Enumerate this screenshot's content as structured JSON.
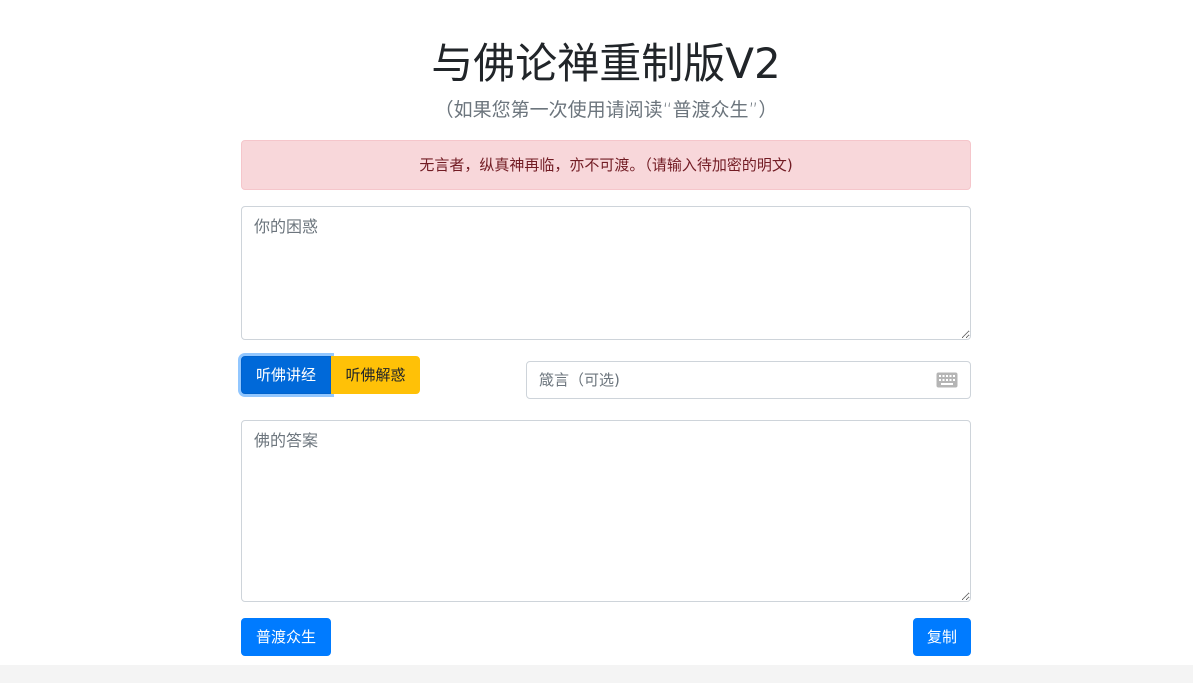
{
  "header": {
    "title": "与佛论禅重制版V2",
    "subtitle": "（如果您第一次使用请阅读“普渡众生”）"
  },
  "alert": {
    "text": "无言者，纵真神再临，亦不可渡。（请输入待加密的明文)"
  },
  "question_box": {
    "placeholder": "你的困惑",
    "value": ""
  },
  "actions": {
    "encrypt_label": "听佛讲经",
    "decrypt_label": "听佛解惑"
  },
  "key_input": {
    "placeholder": "箴言（可选)",
    "value": "",
    "icon": "keyboard-icon"
  },
  "answer_box": {
    "placeholder": "佛的答案",
    "value": ""
  },
  "footer": {
    "help_label": "普渡众生",
    "copy_label": "复制"
  },
  "colors": {
    "primary": "#007bff",
    "primary_active": "#0069d9",
    "warning": "#ffc107",
    "alert_bg": "#f8d7da",
    "alert_text": "#721c24"
  }
}
